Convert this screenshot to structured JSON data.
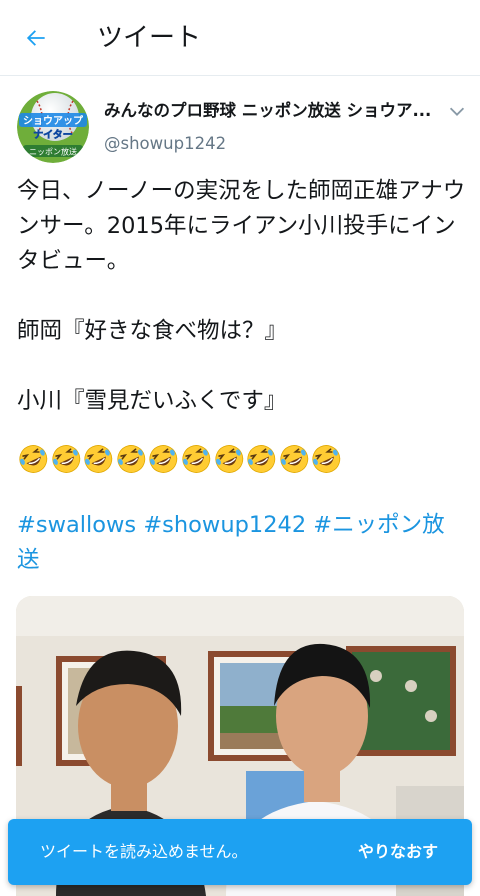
{
  "header": {
    "title": "ツイート",
    "back_icon": "arrow-left-icon",
    "accent": "#1da1f2"
  },
  "author": {
    "display_name": "みんなのプロ野球 ニッポン放送 ショウア...",
    "handle": "@showup1242",
    "avatar_text_line1": "ショウアップ",
    "avatar_text_line2": "ナイター",
    "avatar_text_line3": "ニッポン放送",
    "caret_icon": "chevron-down-icon"
  },
  "tweet": {
    "line1": "今日、ノーノーの実況をした師岡正雄アナウンサー。2015年にライアン小川投手にインタビュー。",
    "line2": "師岡『好きな食べ物は？』",
    "line3": "小川『雪見だいふくです』",
    "emoji_name": "rolling-on-the-floor-laughing-icon",
    "emoji_count": 10,
    "hashtag1": "#swallows",
    "hashtag2": "#showup1242",
    "hashtag3": "#ニッポン放送",
    "hashtag_color": "#1b95e0"
  },
  "toast": {
    "message": "ツイートを読み込めません。",
    "action": "やりなおす",
    "background": "#1da1f2"
  }
}
